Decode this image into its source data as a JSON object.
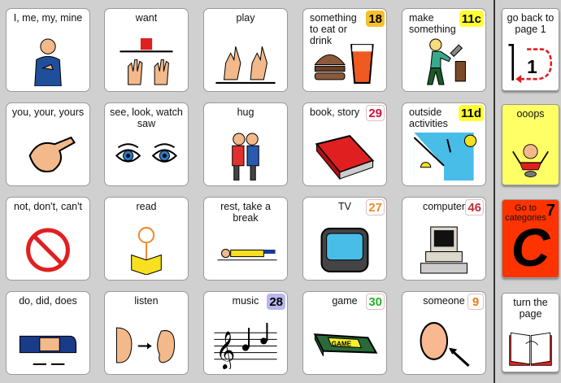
{
  "cells": [
    {
      "label": "I, me, my, mine",
      "icon": "person-pointing-self-icon"
    },
    {
      "label": "want",
      "icon": "hands-reaching-icon"
    },
    {
      "label": "play",
      "icon": "play-sign-hands-icon"
    },
    {
      "label": "something to eat or drink",
      "badge": "18",
      "badge_bg": "#f6c02a",
      "badge_fg": "#000000",
      "icon": "burger-drink-icon"
    },
    {
      "label": "make something",
      "badge": "11c",
      "badge_bg": "#ffff33",
      "badge_fg": "#000000",
      "icon": "person-hammering-icon"
    },
    {
      "label": "you, your, yours",
      "icon": "finger-pointing-icon"
    },
    {
      "label": "see, look, watch saw",
      "icon": "eyes-icon"
    },
    {
      "label": "hug",
      "icon": "hug-icon"
    },
    {
      "label": "book,  story",
      "badge": "29",
      "badge_bg": "#ffffff",
      "badge_fg": "#d0103a",
      "icon": "book-icon"
    },
    {
      "label": "outside activities",
      "badge": "11d",
      "badge_bg": "#ffff33",
      "badge_fg": "#000000",
      "icon": "outside-icon"
    },
    {
      "label": "not, don't, can't",
      "icon": "no-sign-icon"
    },
    {
      "label": "read",
      "icon": "person-reading-icon"
    },
    {
      "label": "rest, take a break",
      "icon": "person-lying-icon"
    },
    {
      "label": "TV",
      "badge": "27",
      "badge_bg": "#ffffff",
      "badge_fg": "#f08a30",
      "icon": "tv-icon"
    },
    {
      "label": "computer",
      "badge": "46",
      "badge_bg": "#ffffff",
      "badge_fg": "#c0303a",
      "icon": "computer-icon"
    },
    {
      "label": "do, did, does",
      "icon": "do-sign-icon"
    },
    {
      "label": "listen",
      "icon": "ear-listen-icon"
    },
    {
      "label": "music",
      "badge": "28",
      "badge_bg": "#b8b8ee",
      "badge_fg": "#000000",
      "icon": "music-notes-icon"
    },
    {
      "label": "game",
      "badge": "30",
      "badge_bg": "#ffffff",
      "badge_fg": "#2ab02a",
      "icon": "game-board-icon"
    },
    {
      "label": "someone",
      "badge": "9",
      "badge_bg": "#ffffff",
      "badge_fg": "#f07a10",
      "icon": "head-pointer-icon"
    }
  ],
  "side": [
    {
      "label": "go back to page 1",
      "bg": "#ffffff",
      "icon": "back-to-page-1-icon",
      "number": "1"
    },
    {
      "label": "ooops",
      "bg": "#ffff66",
      "icon": "oops-person-icon"
    },
    {
      "label": "Go to categories",
      "bg": "#ff3300",
      "badge": "7",
      "letter": "C",
      "icon": "categories-c-icon"
    },
    {
      "label": "turn the page",
      "bg": "#ffffff",
      "icon": "turn-page-icon"
    }
  ]
}
